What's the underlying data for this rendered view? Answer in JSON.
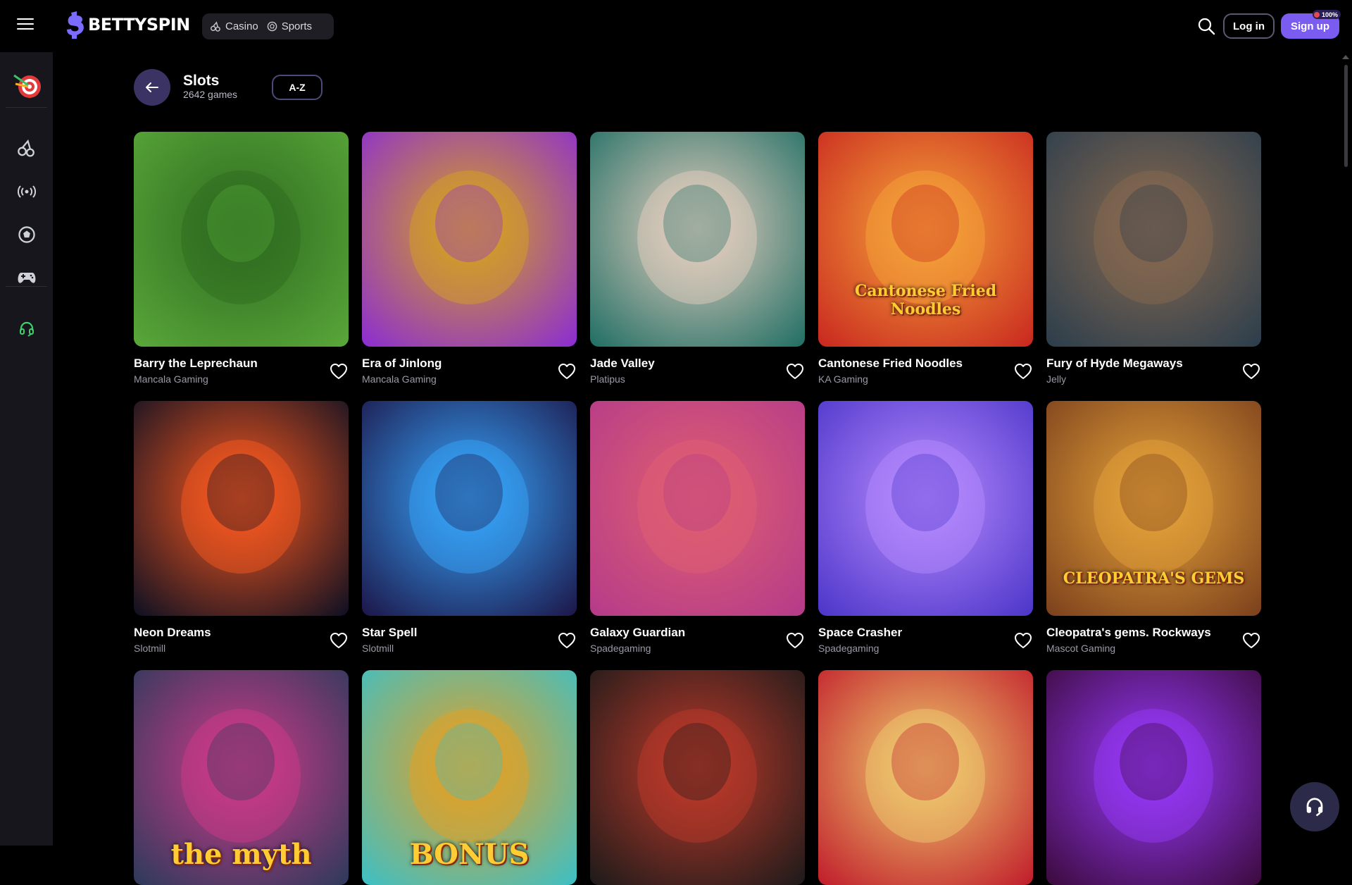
{
  "header": {
    "brand": "BETTYSPIN",
    "nav": [
      {
        "label": "Casino",
        "icon": "cherry-icon"
      },
      {
        "label": "Sports",
        "icon": "soccer-ball-icon"
      }
    ],
    "login_label": "Log in",
    "signup_label": "Sign up",
    "signup_badge": "100%"
  },
  "sidebar": {
    "items": [
      {
        "icon": "darts-target-icon"
      },
      {
        "icon": "cherry-icon"
      },
      {
        "icon": "live-broadcast-icon"
      },
      {
        "icon": "soccer-ball-icon"
      },
      {
        "icon": "gamepad-icon"
      },
      {
        "icon": "headset-icon"
      }
    ]
  },
  "page": {
    "title": "Slots",
    "count": "2642 games",
    "sort_label": "A-Z"
  },
  "games": [
    {
      "name": "Barry the Leprechaun",
      "provider": "Mancala Gaming",
      "colors": [
        "#5aa83a",
        "#2d6a1f"
      ]
    },
    {
      "name": "Era of Jinlong",
      "provider": "Mancala Gaming",
      "colors": [
        "#8a2bd6",
        "#d8a41c"
      ]
    },
    {
      "name": "Jade Valley",
      "provider": "Platipus",
      "colors": [
        "#1e6d63",
        "#e8d0c0"
      ]
    },
    {
      "name": "Cantonese Fried Noodles",
      "provider": "KA Gaming",
      "colors": [
        "#c8261f",
        "#f6a63a"
      ],
      "banner": "Cantonese Fried Noodles"
    },
    {
      "name": "Fury of Hyde Megaways",
      "provider": "Jelly",
      "colors": [
        "#2a3d4c",
        "#8a6a50"
      ]
    },
    {
      "name": "Neon Dreams",
      "provider": "Slotmill",
      "colors": [
        "#0a0f22",
        "#ff5a1f"
      ]
    },
    {
      "name": "Star Spell",
      "provider": "Slotmill",
      "colors": [
        "#1c1446",
        "#37a8ff"
      ]
    },
    {
      "name": "Galaxy Guardian",
      "provider": "Spadegaming",
      "colors": [
        "#b43a8a",
        "#e06070"
      ]
    },
    {
      "name": "Space Crasher",
      "provider": "Spadegaming",
      "colors": [
        "#4a34c8",
        "#b98cff"
      ]
    },
    {
      "name": "Cleopatra's gems. Rockways",
      "provider": "Mascot Gaming",
      "colors": [
        "#7a3f1c",
        "#e7a43a"
      ],
      "banner": "CLEOPATRA'S GEMS"
    },
    {
      "name": "",
      "provider": "",
      "colors": [
        "#2a3a5a",
        "#d23a8a"
      ],
      "banner": "the myth"
    },
    {
      "name": "",
      "provider": "",
      "colors": [
        "#3ac0c8",
        "#e8a020"
      ],
      "banner": "BONUS"
    },
    {
      "name": "",
      "provider": "",
      "colors": [
        "#1a1a1a",
        "#c03a2a"
      ]
    },
    {
      "name": "",
      "provider": "",
      "colors": [
        "#c01a2a",
        "#f0d070"
      ]
    },
    {
      "name": "",
      "provider": "",
      "colors": [
        "#3a0a3a",
        "#9a3aff"
      ]
    }
  ]
}
